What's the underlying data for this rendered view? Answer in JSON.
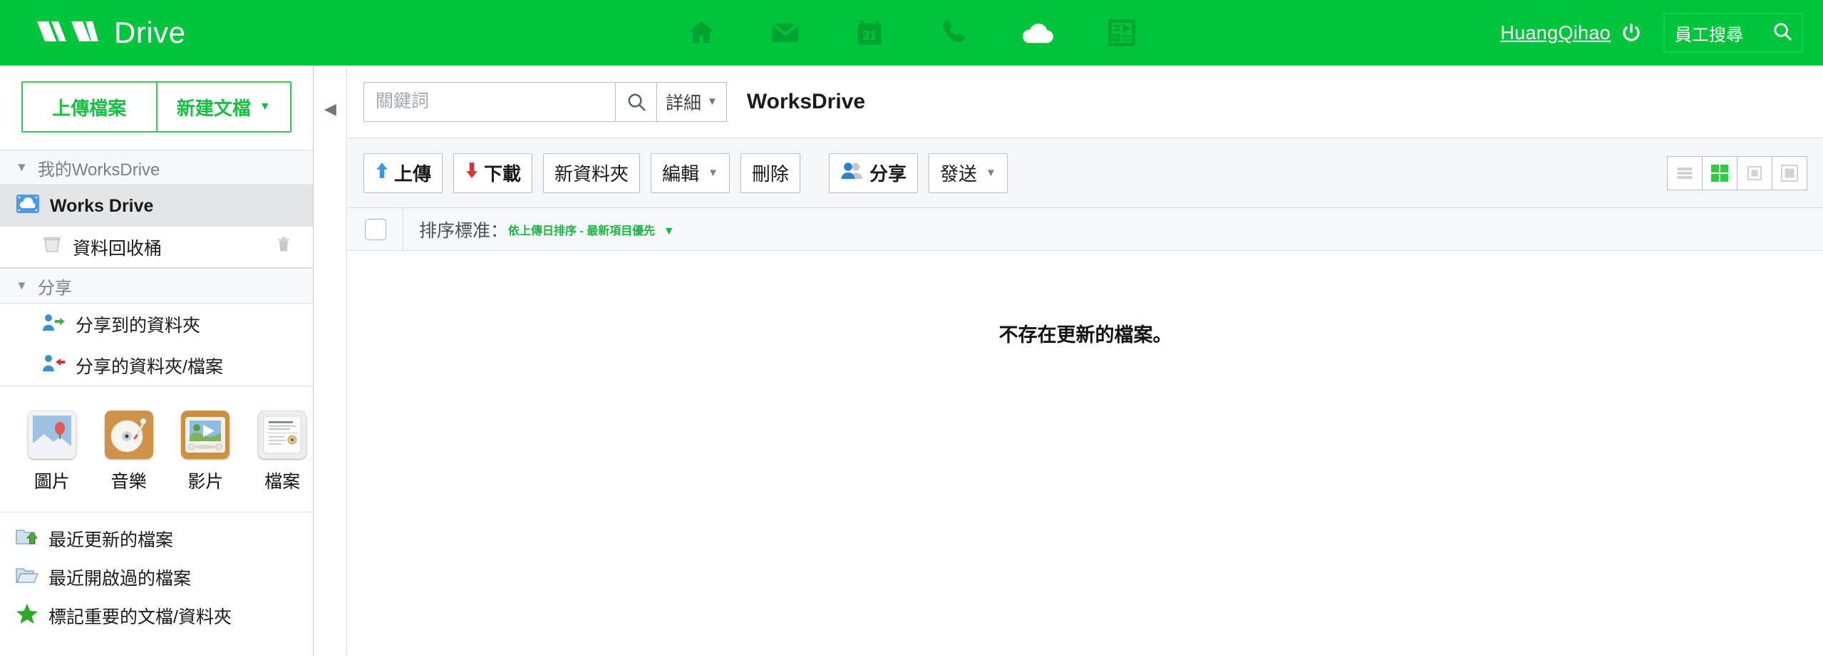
{
  "header": {
    "brand_name": "Drive",
    "logo_icon": "wm-logo-icon",
    "nav": [
      {
        "id": "home",
        "icon": "home-icon",
        "active": false
      },
      {
        "id": "mail",
        "icon": "mail-icon",
        "active": false
      },
      {
        "id": "calendar",
        "icon": "calendar-31-icon",
        "active": false
      },
      {
        "id": "phone",
        "icon": "phone-icon",
        "active": false
      },
      {
        "id": "drive",
        "icon": "cloud-icon",
        "active": true
      },
      {
        "id": "board",
        "icon": "media-board-icon",
        "active": false
      }
    ],
    "user_name": "HuangQihao",
    "power_icon": "power-icon",
    "employee_search": {
      "label": "員工搜尋",
      "icon": "search-icon"
    }
  },
  "sidebar": {
    "upload_button": "上傳檔案",
    "new_doc_button": "新建文檔",
    "sections": [
      {
        "id": "my-worksdrive",
        "title": "我的WorksDrive",
        "items": [
          {
            "id": "works-drive",
            "label": "Works Drive",
            "icon": "cloud-folder-icon",
            "active": true,
            "indent": false,
            "trash_action": false
          },
          {
            "id": "recycle-bin",
            "label": "資料回收桶",
            "icon": "recycle-bin-icon",
            "active": false,
            "indent": true,
            "trash_action": true,
            "trash_icon": "trash-icon"
          }
        ]
      },
      {
        "id": "shared",
        "title": "分享",
        "items": [
          {
            "id": "shared-to-me",
            "label": "分享到的資料夾",
            "icon": "user-share-in-icon",
            "active": false,
            "indent": true,
            "trash_action": false
          },
          {
            "id": "shared-by-me",
            "label": "分享的資料夾/檔案",
            "icon": "user-share-out-icon",
            "active": false,
            "indent": true,
            "trash_action": false
          }
        ]
      }
    ],
    "media_categories": [
      {
        "id": "pictures",
        "label": "圖片",
        "icon": "picture-tile-icon"
      },
      {
        "id": "music",
        "label": "音樂",
        "icon": "music-tile-icon"
      },
      {
        "id": "videos",
        "label": "影片",
        "icon": "video-tile-icon"
      },
      {
        "id": "files",
        "label": "檔案",
        "icon": "document-tile-icon"
      }
    ],
    "quick_links": [
      {
        "id": "recently-updated",
        "label": "最近更新的檔案",
        "icon": "folder-up-icon"
      },
      {
        "id": "recently-opened",
        "label": "最近開啟過的檔案",
        "icon": "folder-open-icon"
      },
      {
        "id": "starred",
        "label": "標記重要的文檔/資料夾",
        "icon": "star-icon"
      }
    ]
  },
  "rail": {
    "collapse_icon": "collapse-left-icon"
  },
  "main": {
    "search": {
      "placeholder": "關鍵詞",
      "value": "",
      "search_icon": "search-icon",
      "detail_label": "詳細",
      "detail_caret": "▼"
    },
    "page_title": "WorksDrive",
    "toolbar": [
      {
        "id": "upload",
        "label": "上傳",
        "icon": "arrow-up-blue-icon",
        "caret": false,
        "bold": true
      },
      {
        "id": "download",
        "label": "下載",
        "icon": "arrow-down-red-icon",
        "caret": false,
        "bold": true
      },
      {
        "id": "new-folder",
        "label": "新資料夾",
        "icon": null,
        "caret": false,
        "bold": false
      },
      {
        "id": "edit",
        "label": "編輯",
        "icon": null,
        "caret": true,
        "bold": false
      },
      {
        "id": "delete",
        "label": "刪除",
        "icon": null,
        "caret": false,
        "bold": false
      },
      {
        "id": "share",
        "label": "分享",
        "icon": "users-icon",
        "caret": false,
        "bold": true
      },
      {
        "id": "send",
        "label": "發送",
        "icon": null,
        "caret": true,
        "bold": false
      }
    ],
    "view_toggles": [
      {
        "id": "list-view",
        "icon": "list-view-icon",
        "active": false
      },
      {
        "id": "grid-view",
        "icon": "grid-view-icon",
        "active": true
      },
      {
        "id": "compact-view",
        "icon": "compact-view-icon",
        "active": false
      },
      {
        "id": "large-view",
        "icon": "large-view-icon",
        "active": false
      }
    ],
    "sort": {
      "checkbox_checked": false,
      "label": "排序標准：",
      "value": "依上傳日排序 - 最新項目優先",
      "caret": "▼"
    },
    "empty_message": "不存在更新的檔案。"
  },
  "colors": {
    "brand_green": "#00c53c",
    "accent_green": "#1bb53f",
    "toolbar_bg": "#f5f6f8",
    "border": "#dcdfe2"
  }
}
